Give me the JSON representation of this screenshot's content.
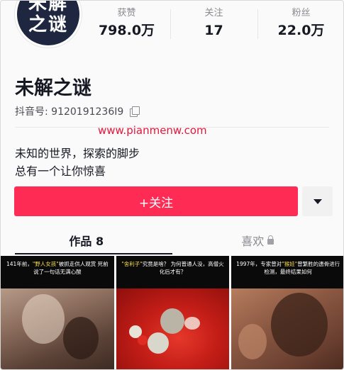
{
  "profile": {
    "avatar_text_1": "未解",
    "avatar_text_2": "之谜",
    "name": "未解之谜",
    "id_label": "抖音号: 9120191236I9",
    "watermark": "www.pianmenw.com",
    "bio_line_1": "未知的世界，探索的脚步",
    "bio_line_2": "总有一个让你惊喜"
  },
  "stats": [
    {
      "label": "获赞",
      "value": "798.0万"
    },
    {
      "label": "关注",
      "value": "17"
    },
    {
      "label": "粉丝",
      "value": "22.0万"
    }
  ],
  "actions": {
    "follow_label": "+关注"
  },
  "tabs": {
    "works": "作品 8",
    "likes": "喜欢"
  },
  "videos": [
    {
      "cap_pre": "141年前，",
      "cap_hl": "\"野人女孩\"",
      "cap_post": "被抓走供人观赏 死前说了一句话无满心酸"
    },
    {
      "cap_pre": "",
      "cap_hl": "\"舍利子\"",
      "cap_post": "究竟是啥？ 为何普通人没，高僧火化后才有？"
    },
    {
      "cap_pre": "1997年，专家曾对",
      "cap_hl": "\"猴娃\"",
      "cap_post": "曾繁胜的遗骨进行检测，最终结果如何"
    }
  ],
  "colors": {
    "accent": "#fe2c55",
    "watermark": "#e5163a"
  }
}
